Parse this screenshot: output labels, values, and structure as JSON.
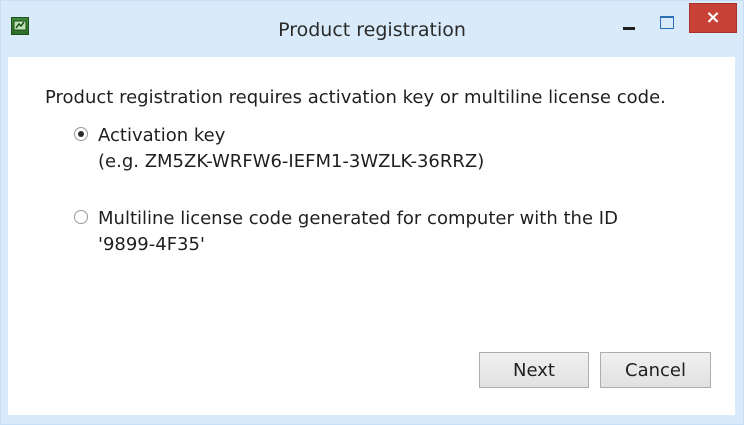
{
  "window": {
    "title": "Product registration",
    "app_icon": "app-icon",
    "controls": {
      "minimize_icon": "minimize-icon",
      "maximize_icon": "maximize-icon",
      "close_label": "×"
    }
  },
  "content": {
    "prompt": "Product registration requires activation key or multiline license code.",
    "options": [
      {
        "line1": "Activation key",
        "line2": "(e.g. ZM5ZK-WRFW6-IEFM1-3WZLK-36RRZ)",
        "selected": true
      },
      {
        "line1": "Multiline license code generated for computer with the ID",
        "line2": "'9899-4F35'",
        "selected": false
      }
    ]
  },
  "buttons": {
    "next_label": "Next",
    "cancel_label": "Cancel"
  },
  "colors": {
    "titlebar": "#d9ebfa",
    "close": "#c74137",
    "content_bg": "#ffffff"
  }
}
